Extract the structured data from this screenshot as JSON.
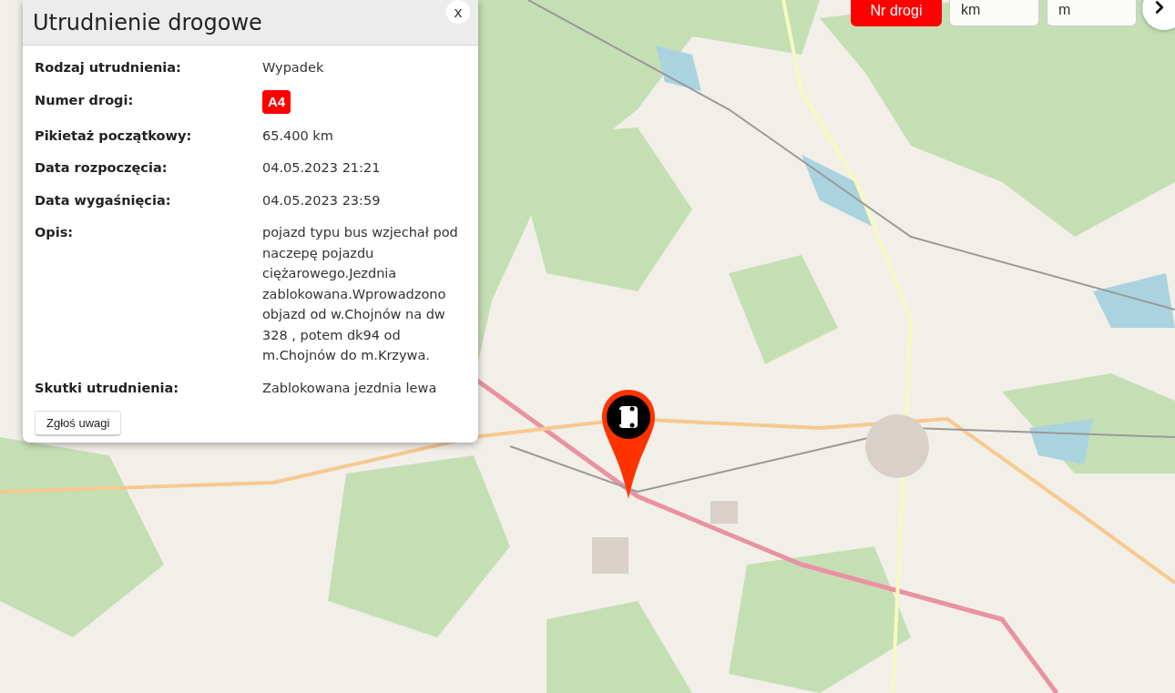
{
  "popup": {
    "title": "Utrudnienie drogowe",
    "close": "x",
    "fields": [
      {
        "label": "Rodzaj utrudnienia:",
        "kind": "text",
        "value": "Wypadek"
      },
      {
        "label": "Numer drogi:",
        "kind": "road",
        "value": "A4"
      },
      {
        "label": "Pikietaż początkowy:",
        "kind": "text",
        "value": "65.400 km"
      },
      {
        "label": "Data rozpoczęcia:",
        "kind": "text",
        "value": "04.05.2023 21:21"
      },
      {
        "label": "Data wygaśnięcia:",
        "kind": "text",
        "value": "04.05.2023 23:59"
      },
      {
        "label": "Opis:",
        "kind": "text",
        "value": "pojazd typu bus wzjechał pod naczepę pojazdu ciężarowego.Jezdnia zablokowana.Wprowadzono objazd od w.Chojnów na dw 328 , potem dk94 od m.Chojnów do m.Krzywa."
      },
      {
        "label": "Skutki utrudnienia:",
        "kind": "text",
        "value": "Zablokowana jezdnia lewa"
      }
    ],
    "report_button": "Zgłoś uwagi"
  },
  "search": {
    "button": "Nr drogi",
    "km_placeholder": "km",
    "m_placeholder": "m"
  }
}
